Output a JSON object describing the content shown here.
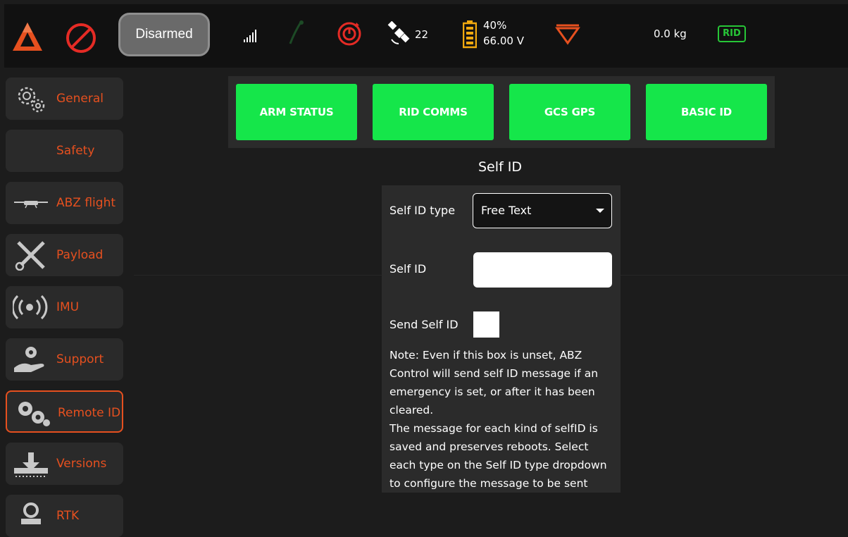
{
  "topbar": {
    "arm_state": "Disarmed",
    "satellites": "22",
    "battery_percent": "40%",
    "battery_voltage": "66.00 V",
    "payload_weight": "0.0 kg",
    "rid_badge": "RID",
    "icons": [
      "logo-icon",
      "no-entry-icon",
      "signal-icon",
      "link-icon",
      "target-icon",
      "satellite-icon",
      "battery-icon",
      "spray-triangle-icon"
    ],
    "colors": {
      "accent": "#e6501f",
      "red": "#e52b25",
      "green": "#27c637",
      "battery": "#f1a90f"
    }
  },
  "sidebar": {
    "items": [
      {
        "label": "General",
        "icon": "gears-icon"
      },
      {
        "label": "Safety",
        "icon": ""
      },
      {
        "label": "ABZ flight",
        "icon": "drone-icon"
      },
      {
        "label": "Payload",
        "icon": "tools-icon"
      },
      {
        "label": "IMU",
        "icon": "broadcast-icon"
      },
      {
        "label": "Support",
        "icon": "hand-gear-icon"
      },
      {
        "label": "Remote ID",
        "icon": "cogs-icon",
        "active": true
      },
      {
        "label": "Versions",
        "icon": "download-icon"
      },
      {
        "label": "RTK",
        "icon": "rtk-icon"
      }
    ]
  },
  "tabs": [
    {
      "label": "ARM STATUS"
    },
    {
      "label": "RID COMMS"
    },
    {
      "label": "GCS GPS"
    },
    {
      "label": "BASIC ID"
    }
  ],
  "section_title": "Self ID",
  "form": {
    "self_id_type_label": "Self ID type",
    "self_id_type_value": "Free Text",
    "self_id_label": "Self ID",
    "self_id_value": "",
    "send_self_id_label": "Send Self ID",
    "send_self_id_checked": false,
    "note_line1": "Note: Even if this box is unset, ABZ Control will send self ID message if an emergency is set, or after it has been cleared.",
    "note_line2": "The message for each kind of selfID is saved and preserves reboots. Select each type on the Self ID type dropdown to configure the message to be sent"
  }
}
